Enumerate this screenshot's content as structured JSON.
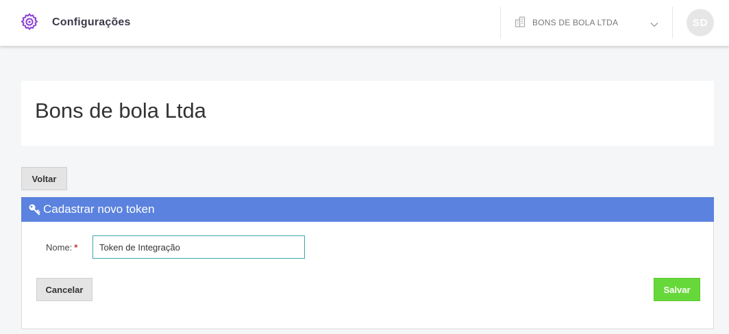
{
  "header": {
    "app_icon": "gear-icon",
    "title": "Configurações",
    "org_icon": "building-icon",
    "org_name": "BONS DE BOLA LTDA",
    "org_chevron": "chevron-down-icon",
    "avatar_initials": "SD"
  },
  "company": {
    "name": "Bons de bola Ltda"
  },
  "actions": {
    "back_label": "Voltar"
  },
  "panel": {
    "icon": "key-icon",
    "title": "Cadastrar novo token",
    "name_label": "Nome:",
    "required_mark": "*",
    "name_value": "Token de Integração",
    "cancel_label": "Cancelar",
    "save_label": "Salvar"
  },
  "colors": {
    "accent_purple": "#8a3fd1",
    "panel_blue": "#5b82de",
    "save_green": "#67d83a",
    "input_border": "#38a8b0"
  }
}
